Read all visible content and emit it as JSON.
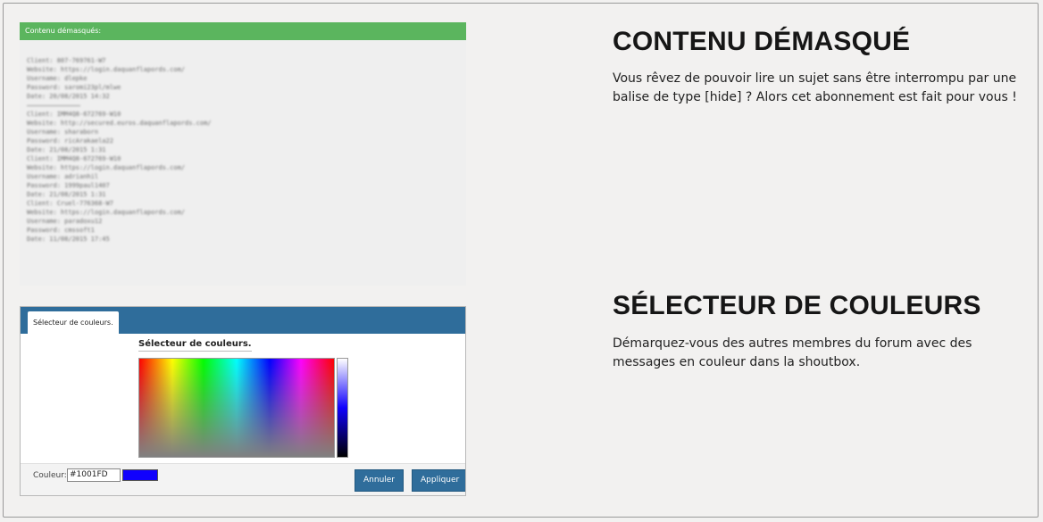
{
  "hidden_content": {
    "bar_title": "Contenu démasqués:",
    "lines_group1": [
      "Client: 807-769761-W7",
      "Website: https://login.daquanflapords.com/",
      "Username: dlepke",
      "Password: saromi23pl/mlwe",
      "Date: 20/08/2015 14:32"
    ],
    "lines_group2": [
      "Client: IMM4Q8-672769-W10",
      "Website: http://secured.euros.daquanflapords.com/",
      "Username: sharaborn",
      "Password: ricArakaela22",
      "Date: 21/08/2015 1:31",
      "Client: IMM4Q8-672769-W10",
      "Website: https://login.daquanflapords.com/",
      "Username: adrianhil",
      "Password: 1999paul1407",
      "Date: 21/08/2015 1:31",
      "Client: Cruel-776368-W7",
      "Website: https://login.daquanflapords.com/",
      "Username: paradoxu12",
      "Password: cmssoft1",
      "Date: 11/08/2015 17:45"
    ]
  },
  "color_picker": {
    "tab_label": "Sélecteur de couleurs.",
    "title": "Sélecteur de couleurs.",
    "color_label": "Couleur:",
    "color_value": "#1001FD",
    "swatch_color": "#1001FD",
    "cancel_label": "Annuler",
    "apply_label": "Appliquer"
  },
  "features": [
    {
      "heading": "CONTENU DÉMASQUÉ",
      "description": "Vous rêvez de pouvoir lire un sujet sans être interrompu par une balise de type [hide] ? Alors cet abonnement est fait pour vous !"
    },
    {
      "heading": "SÉLECTEUR DE COULEURS",
      "description": "Démarquez-vous des autres membres du forum avec des messages en couleur dans la shoutbox."
    }
  ]
}
